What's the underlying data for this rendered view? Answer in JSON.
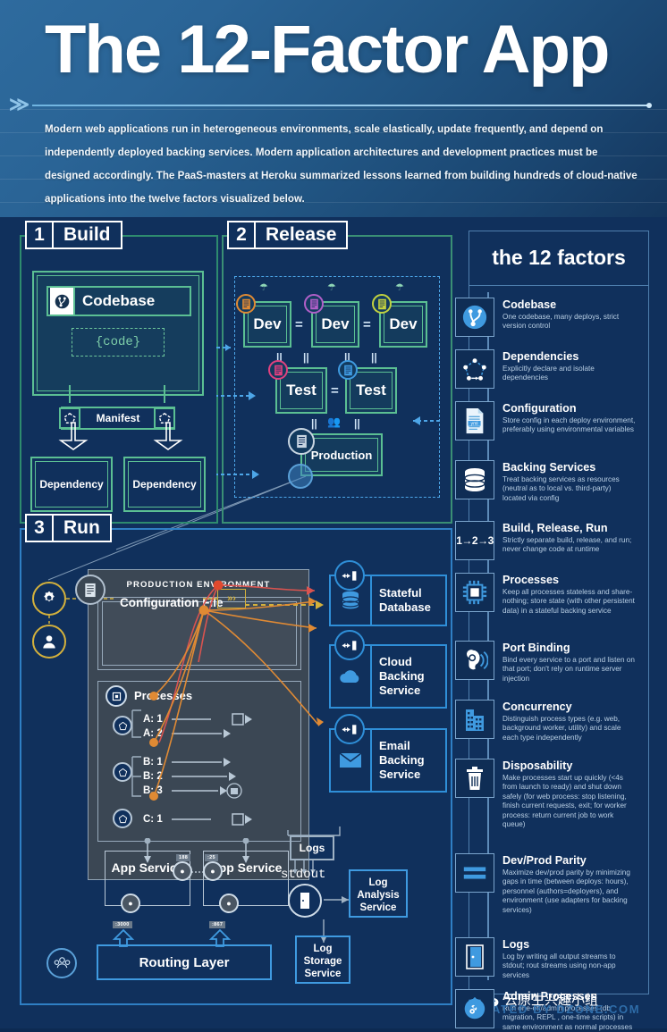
{
  "header": {
    "title": "The 12-Factor App",
    "subtitle": "Modern web applications run in heterogeneous environments, scale elastically, update frequently, and depend on independently deployed backing services. Modern application architectures and development practices must be designed accordingly. The PaaS-masters at Heroku summarized lessons learned from building hundreds of cloud-native applications into the twelve factors visualized below.",
    "chevron_icon": "double-chevron-right-icon"
  },
  "panels": {
    "build": {
      "number": "1",
      "name": "Build",
      "codebase_label": "Codebase",
      "codebase_icon": "git-branch-icon",
      "code_block": "{code}",
      "manifest_label": "Manifest",
      "dependency_1": "Dependency",
      "dependency_2": "Dependency"
    },
    "release": {
      "number": "2",
      "name": "Release",
      "envs": [
        {
          "label": "Dev",
          "color": "#e08a34"
        },
        {
          "label": "Dev",
          "color": "#b05fc8"
        },
        {
          "label": "Dev",
          "color": "#c3d23f"
        },
        {
          "label": "Test",
          "color": "#e0417f"
        },
        {
          "label": "Test",
          "color": "#3f9ae0"
        },
        {
          "label": "Production",
          "color": "#c9d6e2"
        }
      ],
      "equals": "=",
      "parallel": "||"
    },
    "run": {
      "number": "3",
      "name": "Run",
      "production_environment": "PRODUCTION ENVIRONMENT",
      "config_file": "Configuration File",
      "config_arrow": "»›",
      "processes_label": "Processes",
      "process_rows": [
        "A: 1",
        "A: 2",
        "B: 1",
        "B: 2",
        "B: 3",
        "C: 1"
      ],
      "app_service_1": "App Service",
      "app_service_2": "App Service",
      "routing_layer": "Routing Layer",
      "logs_label": "Logs",
      "stdout_label": "stdout",
      "log_analysis_service": "Log Analysis Service",
      "log_storage_service": "Log Storage Service",
      "ports": [
        "188",
        ":25",
        ":3000",
        ":867"
      ],
      "backing_services": [
        {
          "label": "Stateful Database",
          "icon": "database-icon"
        },
        {
          "label": "Cloud Backing Service",
          "icon": "cloud-icon"
        },
        {
          "label": "Email Backing Service",
          "icon": "envelope-icon"
        }
      ],
      "config_icons": [
        "gear-config-icon",
        "user-admin-icon"
      ]
    }
  },
  "sidebar": {
    "title": "the 12 factors",
    "factors": [
      {
        "name": "Codebase",
        "desc": "One codebase, many deploys, strict version control",
        "icon": "git-branch-icon"
      },
      {
        "name": "Dependencies",
        "desc": "Explicitly declare and isolate dependencies",
        "icon": "node-graph-icon"
      },
      {
        "name": "Configuration",
        "desc": "Store config in each deploy environment, preferably using environmental variables",
        "icon": "yaml-file-icon"
      },
      {
        "name": "Backing Services",
        "desc": "Treat backing services as resources (neutral as to local vs. third-party) located via config",
        "icon": "database-icon"
      },
      {
        "name": "Build, Release, Run",
        "desc": "Strictly separate build, release, and run; never change code at runtime",
        "icon": "one-two-three-icon"
      },
      {
        "name": "Processes",
        "desc": "Keep all processes stateless and share-nothing; store state (with other persistent data) in a stateful backing service",
        "icon": "cpu-chip-icon"
      },
      {
        "name": "Port Binding",
        "desc": "Bind every service to a port and listen on that port; don't rely on runtime server injection",
        "icon": "ear-listen-icon"
      },
      {
        "name": "Concurrency",
        "desc": "Distinguish process types (e.g. web, background worker, utility) and scale each type independently",
        "icon": "building-scale-icon"
      },
      {
        "name": "Disposability",
        "desc": "Make processes start up quickly (<4s from launch to ready) and shut down safely (for web process: stop listening, finish current requests, exit; for worker process: return current job to work queue)",
        "icon": "trash-bin-icon"
      },
      {
        "name": "Dev/Prod Parity",
        "desc": "Maximize dev/prod parity by minimizing gaps in time (between deploys: hours), personnel (authors=deployers), and environment (use adapters for backing services)",
        "icon": "equal-bars-icon"
      },
      {
        "name": "Logs",
        "desc": "Log by writing all output streams to stdout; rout streams using non-app services",
        "icon": "open-door-icon"
      },
      {
        "name": "Admin Processes",
        "desc": "Run one-off/admin processes (db migration, REPL , one-time scripts) in same environment as normal processes",
        "icon": "gear-wrench-icon"
      }
    ]
  },
  "footer": {
    "credit": "CREATED BY DZONE.COM",
    "watermark": "云原生兴趣小组",
    "watermark_icon": "wechat-icon"
  },
  "colors": {
    "build_green": "#5bbf93",
    "release_green": "#3a8f74",
    "run_blue": "#2f7fc4",
    "accent_blue": "#3f9ae0",
    "config_yellow": "#d4b13c",
    "flow_red": "#d9534f",
    "flow_orange": "#e08a34"
  }
}
